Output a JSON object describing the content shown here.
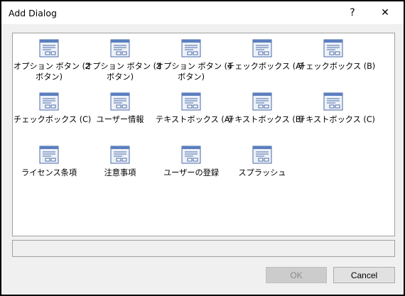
{
  "window": {
    "title": "Add Dialog",
    "help_glyph": "?",
    "close_glyph": "✕"
  },
  "items": [
    {
      "line1": "オプション ボタン (2",
      "line2": "ボタン)",
      "icon": "dialog-template-icon"
    },
    {
      "line1": "オプション ボタン (3",
      "line2": "ボタン)",
      "icon": "dialog-template-icon"
    },
    {
      "line1": "オプション ボタン (4",
      "line2": "ボタン)",
      "icon": "dialog-template-icon"
    },
    {
      "line1": "チェックボックス (A)",
      "line2": "",
      "icon": "dialog-template-icon"
    },
    {
      "line1": "チェックボックス (B)",
      "line2": "",
      "icon": "dialog-template-icon"
    },
    {
      "line1": "チェックボックス (C)",
      "line2": "",
      "icon": "dialog-template-icon"
    },
    {
      "line1": "ユーザー情報",
      "line2": "",
      "icon": "dialog-template-icon"
    },
    {
      "line1": "テキストボックス (A)",
      "line2": "",
      "icon": "dialog-template-icon"
    },
    {
      "line1": "テキストボックス (B)",
      "line2": "",
      "icon": "dialog-template-icon"
    },
    {
      "line1": "テキストボックス (C)",
      "line2": "",
      "icon": "dialog-template-icon"
    },
    {
      "line1": "ライセンス条項",
      "line2": "",
      "icon": "dialog-template-icon"
    },
    {
      "line1": "注意事項",
      "line2": "",
      "icon": "dialog-template-icon"
    },
    {
      "line1": "ユーザーの登録",
      "line2": "",
      "icon": "dialog-template-icon"
    },
    {
      "line1": "スプラッシュ",
      "line2": "",
      "icon": "dialog-template-icon"
    }
  ],
  "description": "",
  "buttons": {
    "ok_label": "OK",
    "ok_enabled": false,
    "cancel_label": "Cancel"
  },
  "colors": {
    "icon_titlebar": "#5b7fbf",
    "icon_body": "#eef2f8",
    "icon_lines": "#4a6aa8"
  }
}
